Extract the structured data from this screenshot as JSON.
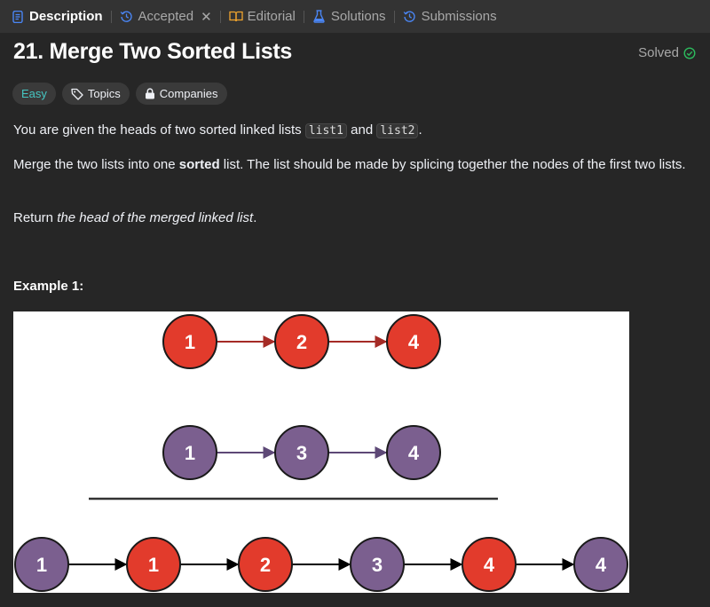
{
  "tabs": [
    {
      "label": "Description",
      "icon": "description-icon",
      "color": "#4a86f5"
    },
    {
      "label": "Accepted",
      "icon": "history-icon",
      "color": "#4a86f5"
    },
    {
      "label": "Editorial",
      "icon": "book-icon",
      "color": "#f0a42e"
    },
    {
      "label": "Solutions",
      "icon": "flask-icon",
      "color": "#4a86f5"
    },
    {
      "label": "Submissions",
      "icon": "history-icon",
      "color": "#4a86f5"
    }
  ],
  "problem": {
    "title": "21. Merge Two Sorted Lists",
    "status": "Solved",
    "status_color": "#2cbb5d"
  },
  "tags": {
    "difficulty": "Easy",
    "difficulty_color": "#46c6c2",
    "topics": "Topics",
    "companies": "Companies"
  },
  "description": {
    "p1_before": "You are given the heads of two sorted linked lists ",
    "p1_code1": "list1",
    "p1_mid": " and ",
    "p1_code2": "list2",
    "p1_after": ".",
    "p2_before": "Merge the two lists into one ",
    "p2_bold": "sorted",
    "p2_after": " list. The list should be made by splicing together the nodes of the first two lists.",
    "p3_before": "Return ",
    "p3_italic": "the head of the merged linked list",
    "p3_after": "."
  },
  "example": {
    "title": "Example 1:",
    "list1": [
      "1",
      "2",
      "4"
    ],
    "list2": [
      "1",
      "3",
      "4"
    ],
    "merged": [
      {
        "v": "1",
        "from": "list2"
      },
      {
        "v": "1",
        "from": "list1"
      },
      {
        "v": "2",
        "from": "list1"
      },
      {
        "v": "3",
        "from": "list2"
      },
      {
        "v": "4",
        "from": "list1"
      },
      {
        "v": "4",
        "from": "list2"
      }
    ],
    "colors": {
      "list1": "#e23b2c",
      "list2": "#7b5f8f",
      "list1_arrow": "#a52b26",
      "list2_arrow": "#5d4876",
      "merged_arrow": "#000000"
    }
  }
}
